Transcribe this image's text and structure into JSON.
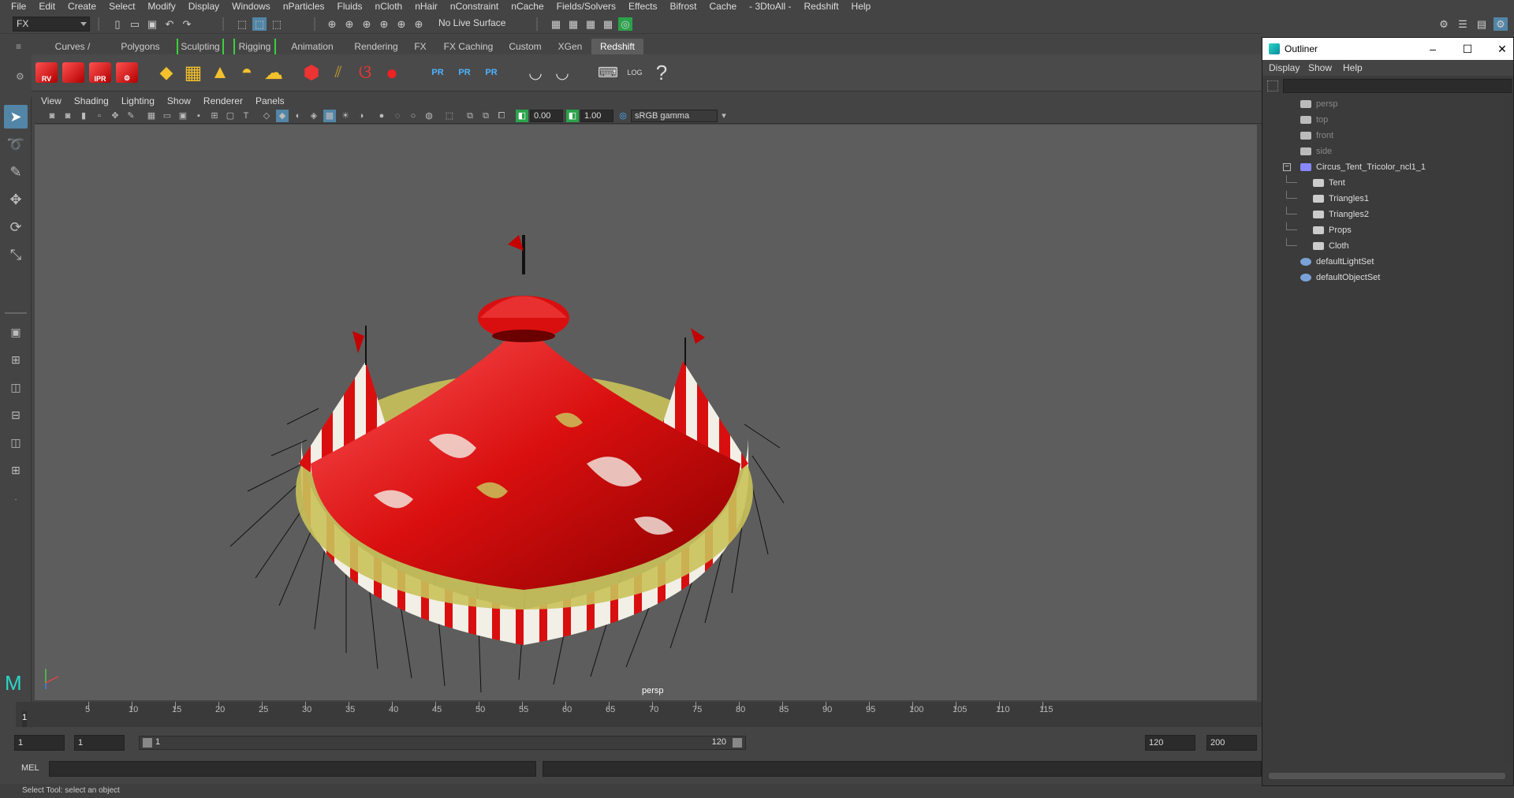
{
  "menubar": [
    "File",
    "Edit",
    "Create",
    "Select",
    "Modify",
    "Display",
    "Windows",
    "nParticles",
    "Fluids",
    "nCloth",
    "nHair",
    "nConstraint",
    "nCache",
    "Fields/Solvers",
    "Effects",
    "Bifrost",
    "Cache",
    "- 3DtoAll -",
    "Redshift",
    "Help"
  ],
  "statusline": {
    "menuset": "FX",
    "live_surface": "No Live Surface"
  },
  "shelf_tabs": [
    "Curves / Surfaces",
    "Polygons",
    "Sculpting",
    "Rigging",
    "Animation",
    "Rendering",
    "FX",
    "FX Caching",
    "Custom",
    "XGen",
    "Redshift"
  ],
  "active_shelf_tab": "Redshift",
  "shelf_buttons": {
    "rv": "RV",
    "ipr": "IPR",
    "pr": "PR",
    "log": "LOG",
    "help": "?"
  },
  "panel_menu": [
    "View",
    "Shading",
    "Lighting",
    "Show",
    "Renderer",
    "Panels"
  ],
  "panel_toolbar": {
    "exposure": "0.00",
    "gamma": "1.00",
    "color_space": "sRGB gamma"
  },
  "viewport": {
    "camera_label": "persp"
  },
  "timeline": {
    "ticks": [
      5,
      10,
      15,
      20,
      25,
      30,
      35,
      40,
      45,
      50,
      55,
      60,
      65,
      70,
      75,
      80,
      85,
      90,
      95,
      100,
      105,
      110,
      115
    ],
    "current_frame": "1"
  },
  "range": {
    "start_field": "1",
    "playback_start": "1",
    "range_start_label": "1",
    "range_end_label": "120",
    "playback_end": "120",
    "end_field": "200"
  },
  "commandline": {
    "label": "MEL"
  },
  "helpline": "Select Tool: select an object",
  "outliner": {
    "title": "Outliner",
    "menu": [
      "Display",
      "Show",
      "Help"
    ],
    "items": [
      {
        "label": "persp",
        "type": "camera",
        "dim": true
      },
      {
        "label": "top",
        "type": "camera",
        "dim": true
      },
      {
        "label": "front",
        "type": "camera",
        "dim": true
      },
      {
        "label": "side",
        "type": "camera",
        "dim": true
      },
      {
        "label": "Circus_Tent_Tricolor_ncl1_1",
        "type": "group",
        "dim": false
      },
      {
        "label": "Tent",
        "type": "mesh",
        "dim": false
      },
      {
        "label": "Triangles1",
        "type": "mesh",
        "dim": false
      },
      {
        "label": "Triangles2",
        "type": "mesh",
        "dim": false
      },
      {
        "label": "Props",
        "type": "mesh",
        "dim": false
      },
      {
        "label": "Cloth",
        "type": "mesh",
        "dim": false
      },
      {
        "label": "defaultLightSet",
        "type": "set",
        "dim": false
      },
      {
        "label": "defaultObjectSet",
        "type": "set",
        "dim": false
      }
    ]
  },
  "colors": {
    "tent_red": "#d90f0f",
    "tent_white": "#f2efe6",
    "tent_gold": "#c9c25a",
    "viewport_bg": "#5d5d5d",
    "selection_blue": "#5285a6"
  }
}
